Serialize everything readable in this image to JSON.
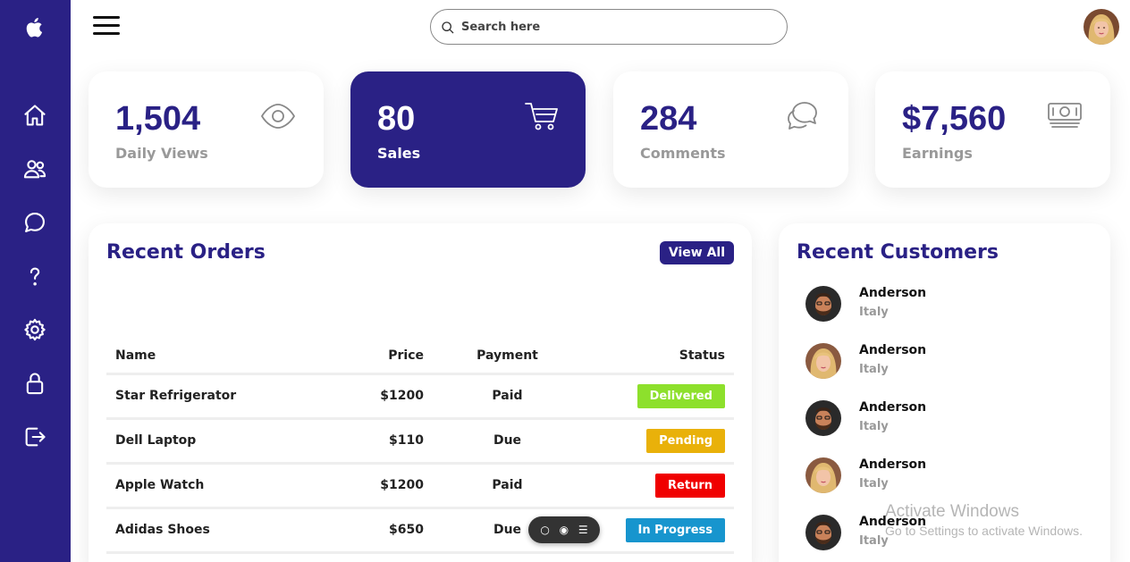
{
  "sidebar": {
    "logo": "apple-icon",
    "items": [
      {
        "icon": "home-icon",
        "label": "Dashboard"
      },
      {
        "icon": "people-icon",
        "label": "Customers"
      },
      {
        "icon": "chat-icon",
        "label": "Messages"
      },
      {
        "icon": "help-icon",
        "label": "Help"
      },
      {
        "icon": "settings-icon",
        "label": "Settings"
      },
      {
        "icon": "lock-icon",
        "label": "Password"
      },
      {
        "icon": "sign-out-icon",
        "label": "Sign Out"
      }
    ]
  },
  "topbar": {
    "search_placeholder": "Search here"
  },
  "cards": [
    {
      "number": "1,504",
      "label": "Daily Views",
      "icon": "eye-icon",
      "active": false
    },
    {
      "number": "80",
      "label": "Sales",
      "icon": "cart-icon",
      "active": true
    },
    {
      "number": "284",
      "label": "Comments",
      "icon": "comments-icon",
      "active": false
    },
    {
      "number": "$7,560",
      "label": "Earnings",
      "icon": "cash-icon",
      "active": false
    }
  ],
  "orders": {
    "title": "Recent Orders",
    "view_all": "View All",
    "headers": {
      "name": "Name",
      "price": "Price",
      "payment": "Payment",
      "status": "Status"
    },
    "rows": [
      {
        "name": "Star Refrigerator",
        "price": "$1200",
        "payment": "Paid",
        "status": "Delivered",
        "color": "#8de02c"
      },
      {
        "name": "Dell Laptop",
        "price": "$110",
        "payment": "Due",
        "status": "Pending",
        "color": "#e9b10a"
      },
      {
        "name": "Apple Watch",
        "price": "$1200",
        "payment": "Paid",
        "status": "Return",
        "color": "#f00000"
      },
      {
        "name": "Adidas Shoes",
        "price": "$650",
        "payment": "Due",
        "status": "In Progress",
        "color": "#1795ce"
      }
    ]
  },
  "customers": {
    "title": "Recent Customers",
    "list": [
      {
        "name": "Anderson",
        "country": "Italy",
        "avatar": "man"
      },
      {
        "name": "Anderson",
        "country": "Italy",
        "avatar": "woman"
      },
      {
        "name": "Anderson",
        "country": "Italy",
        "avatar": "man"
      },
      {
        "name": "Anderson",
        "country": "Italy",
        "avatar": "woman"
      },
      {
        "name": "Anderson",
        "country": "Italy",
        "avatar": "man"
      }
    ]
  },
  "watermark": {
    "line1": "Activate Windows",
    "line2": "Go to Settings to activate Windows."
  },
  "colors": {
    "primary": "#2a2185",
    "delivered": "#8de02c",
    "pending": "#e9b10a",
    "return": "#f00000",
    "in_progress": "#1795ce"
  }
}
